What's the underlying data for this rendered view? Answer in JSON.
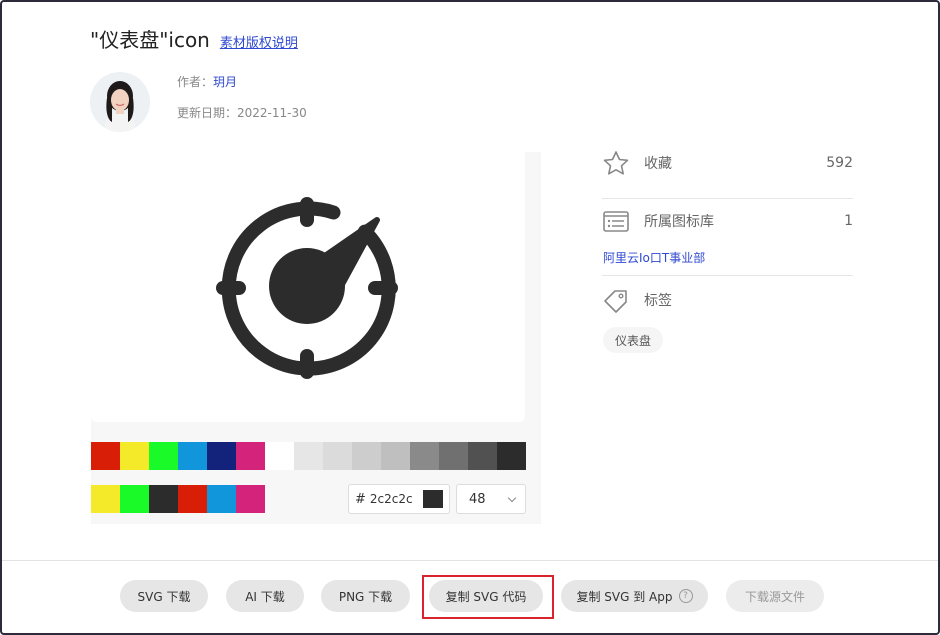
{
  "header": {
    "title": "\"仪表盘\"icon",
    "copyright_link": "素材版权说明"
  },
  "author": {
    "label": "作者：",
    "name": "玥月",
    "date_label": "更新日期：",
    "date": "2022-11-30"
  },
  "palette": {
    "row1": [
      "#d81e06",
      "#f4ea2a",
      "#1afa29",
      "#1296db",
      "#13227a",
      "#d4237a",
      "#ffffff",
      "#e6e6e6",
      "#dbdbdb",
      "#cdcdcd",
      "#bfbfbf",
      "#8a8a8a",
      "#707070",
      "#515151",
      "#2c2c2c"
    ],
    "row2": [
      "#f4ea2a",
      "#1afa29",
      "#2c2c2c",
      "#d81e06",
      "#1296db",
      "#d4237a"
    ],
    "hex_hash": "#",
    "hex_value": "2c2c2c",
    "size_value": "48"
  },
  "sidebar": {
    "favorite_label": "收藏",
    "favorite_count": "592",
    "library_label": "所属图标库",
    "library_count": "1",
    "library_name": "阿里云Io口T事业部",
    "tags_label": "标签",
    "tags": [
      "仪表盘"
    ]
  },
  "actions": {
    "svg_download": "SVG 下载",
    "ai_download": "AI 下载",
    "png_download": "PNG 下载",
    "copy_svg_code": "复制 SVG 代码",
    "copy_svg_to_app": "复制 SVG 到 App",
    "download_source": "下载源文件",
    "help_glyph": "?"
  },
  "icon_color": "#2c2c2c",
  "accent_link_color": "#2f49d1",
  "highlight_color": "#d9232d"
}
